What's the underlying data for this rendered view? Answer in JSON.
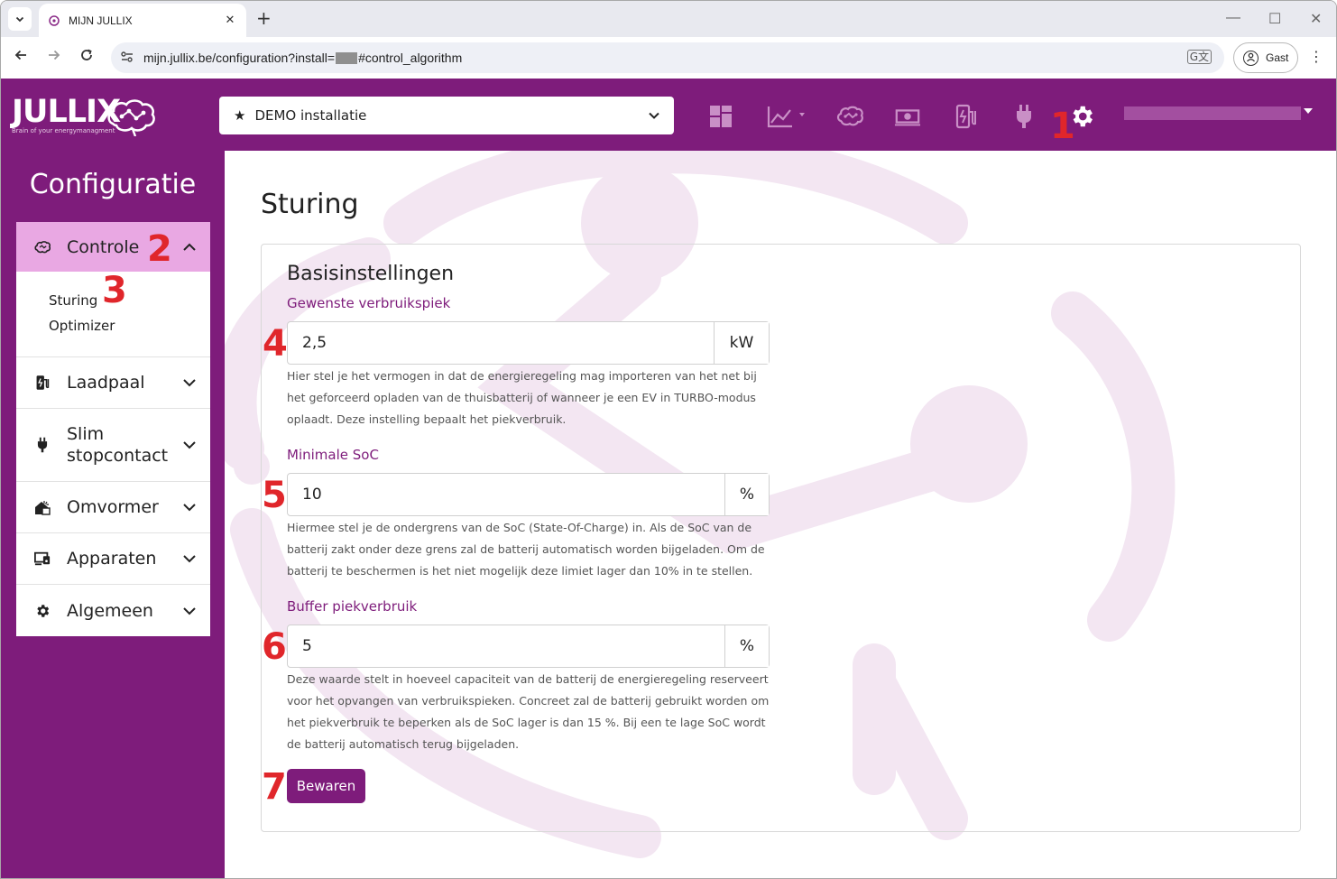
{
  "browser": {
    "tab_title": "MIJN JULLIX",
    "url_prefix": "mijn.jullix.be/configuration?install=",
    "url_suffix": "#control_algorithm",
    "profile_label": "Gast"
  },
  "topnav": {
    "logo_text": "JULLIX",
    "logo_tagline": "Brain of your energymanagment",
    "installation": "DEMO installatie",
    "icons": [
      "dashboard-icon",
      "chart-icon",
      "brain-icon",
      "money-icon",
      "charger-icon",
      "plug-icon",
      "gear-icon"
    ]
  },
  "sidebar": {
    "title": "Configuratie",
    "items": [
      {
        "label": "Controle",
        "icon": "brain-icon",
        "expanded": true,
        "sub": [
          "Sturing",
          "Optimizer"
        ]
      },
      {
        "label": "Laadpaal",
        "icon": "charger-icon"
      },
      {
        "label": "Slim stopcontact",
        "icon": "plug-icon"
      },
      {
        "label": "Omvormer",
        "icon": "home-solar-icon"
      },
      {
        "label": "Apparaten",
        "icon": "devices-icon"
      },
      {
        "label": "Algemeen",
        "icon": "gear-icon"
      }
    ]
  },
  "main": {
    "page_title": "Sturing",
    "card_title": "Basisinstellingen",
    "fields": [
      {
        "label": "Gewenste verbruikspiek",
        "value": "2,5",
        "unit": "kW",
        "help": "Hier stel je het vermogen in dat de energieregeling mag importeren van het net bij het geforceerd opladen van de thuisbatterij of wanneer je een EV in TURBO-modus oplaadt. Deze instelling bepaalt het piekverbruik."
      },
      {
        "label": "Minimale SoC",
        "value": "10",
        "unit": "%",
        "help": "Hiermee stel je de ondergrens van de SoC (State-Of-Charge) in. Als de SoC van de batterij zakt onder deze grens zal de batterij automatisch worden bijgeladen. Om de batterij te beschermen is het niet mogelijk deze limiet lager dan 10% in te stellen."
      },
      {
        "label": "Buffer piekverbruik",
        "value": "5",
        "unit": "%",
        "help": "Deze waarde stelt in hoeveel capaciteit van de batterij de energieregeling reserveert voor het opvangen van verbruikspieken. Concreet zal de batterij gebruikt worden om het piekverbruik te beperken als de SoC lager is dan 15 %. Bij een te lage SoC wordt de batterij automatisch terug bijgeladen."
      }
    ],
    "save_label": "Bewaren"
  },
  "markers": [
    "1",
    "2",
    "3",
    "4",
    "5",
    "6",
    "7"
  ],
  "colors": {
    "brand": "#7e1c7b",
    "active_menu": "#e9a8e3",
    "marker": "#e0262b"
  }
}
